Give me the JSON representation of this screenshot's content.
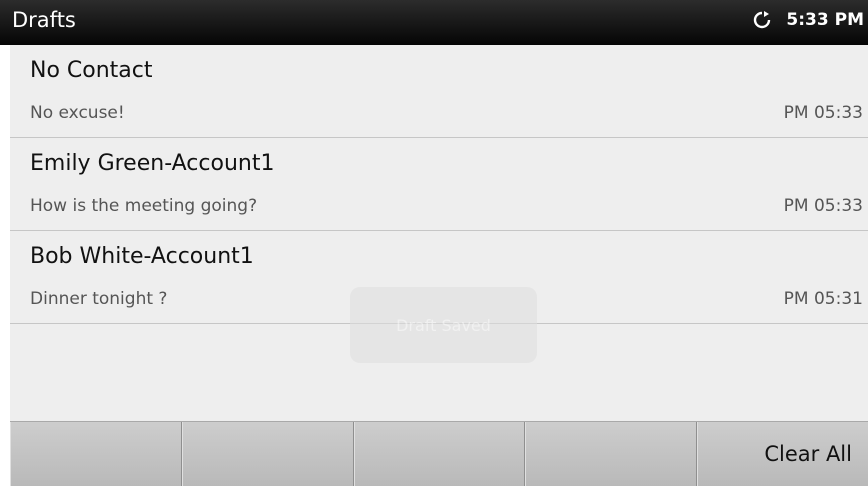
{
  "status_bar": {
    "title": "Drafts",
    "time": "5:33 PM",
    "sync_icon": "sync-icon"
  },
  "drafts": [
    {
      "contact": "No Contact",
      "preview": "No excuse!",
      "time": "PM 05:33"
    },
    {
      "contact": "Emily Green-Account1",
      "preview": "How is the meeting going?",
      "time": "PM 05:33"
    },
    {
      "contact": "Bob White-Account1",
      "preview": "Dinner tonight ?",
      "time": "PM 05:31"
    }
  ],
  "toast": {
    "text": "Draft Saved"
  },
  "softkeys": [
    "",
    "",
    "",
    "",
    "Clear All"
  ],
  "colors": {
    "status_bar_bg": "#0a0a0a",
    "list_bg": "#eeeeee",
    "softkey_bg": "#c4c4c4"
  }
}
